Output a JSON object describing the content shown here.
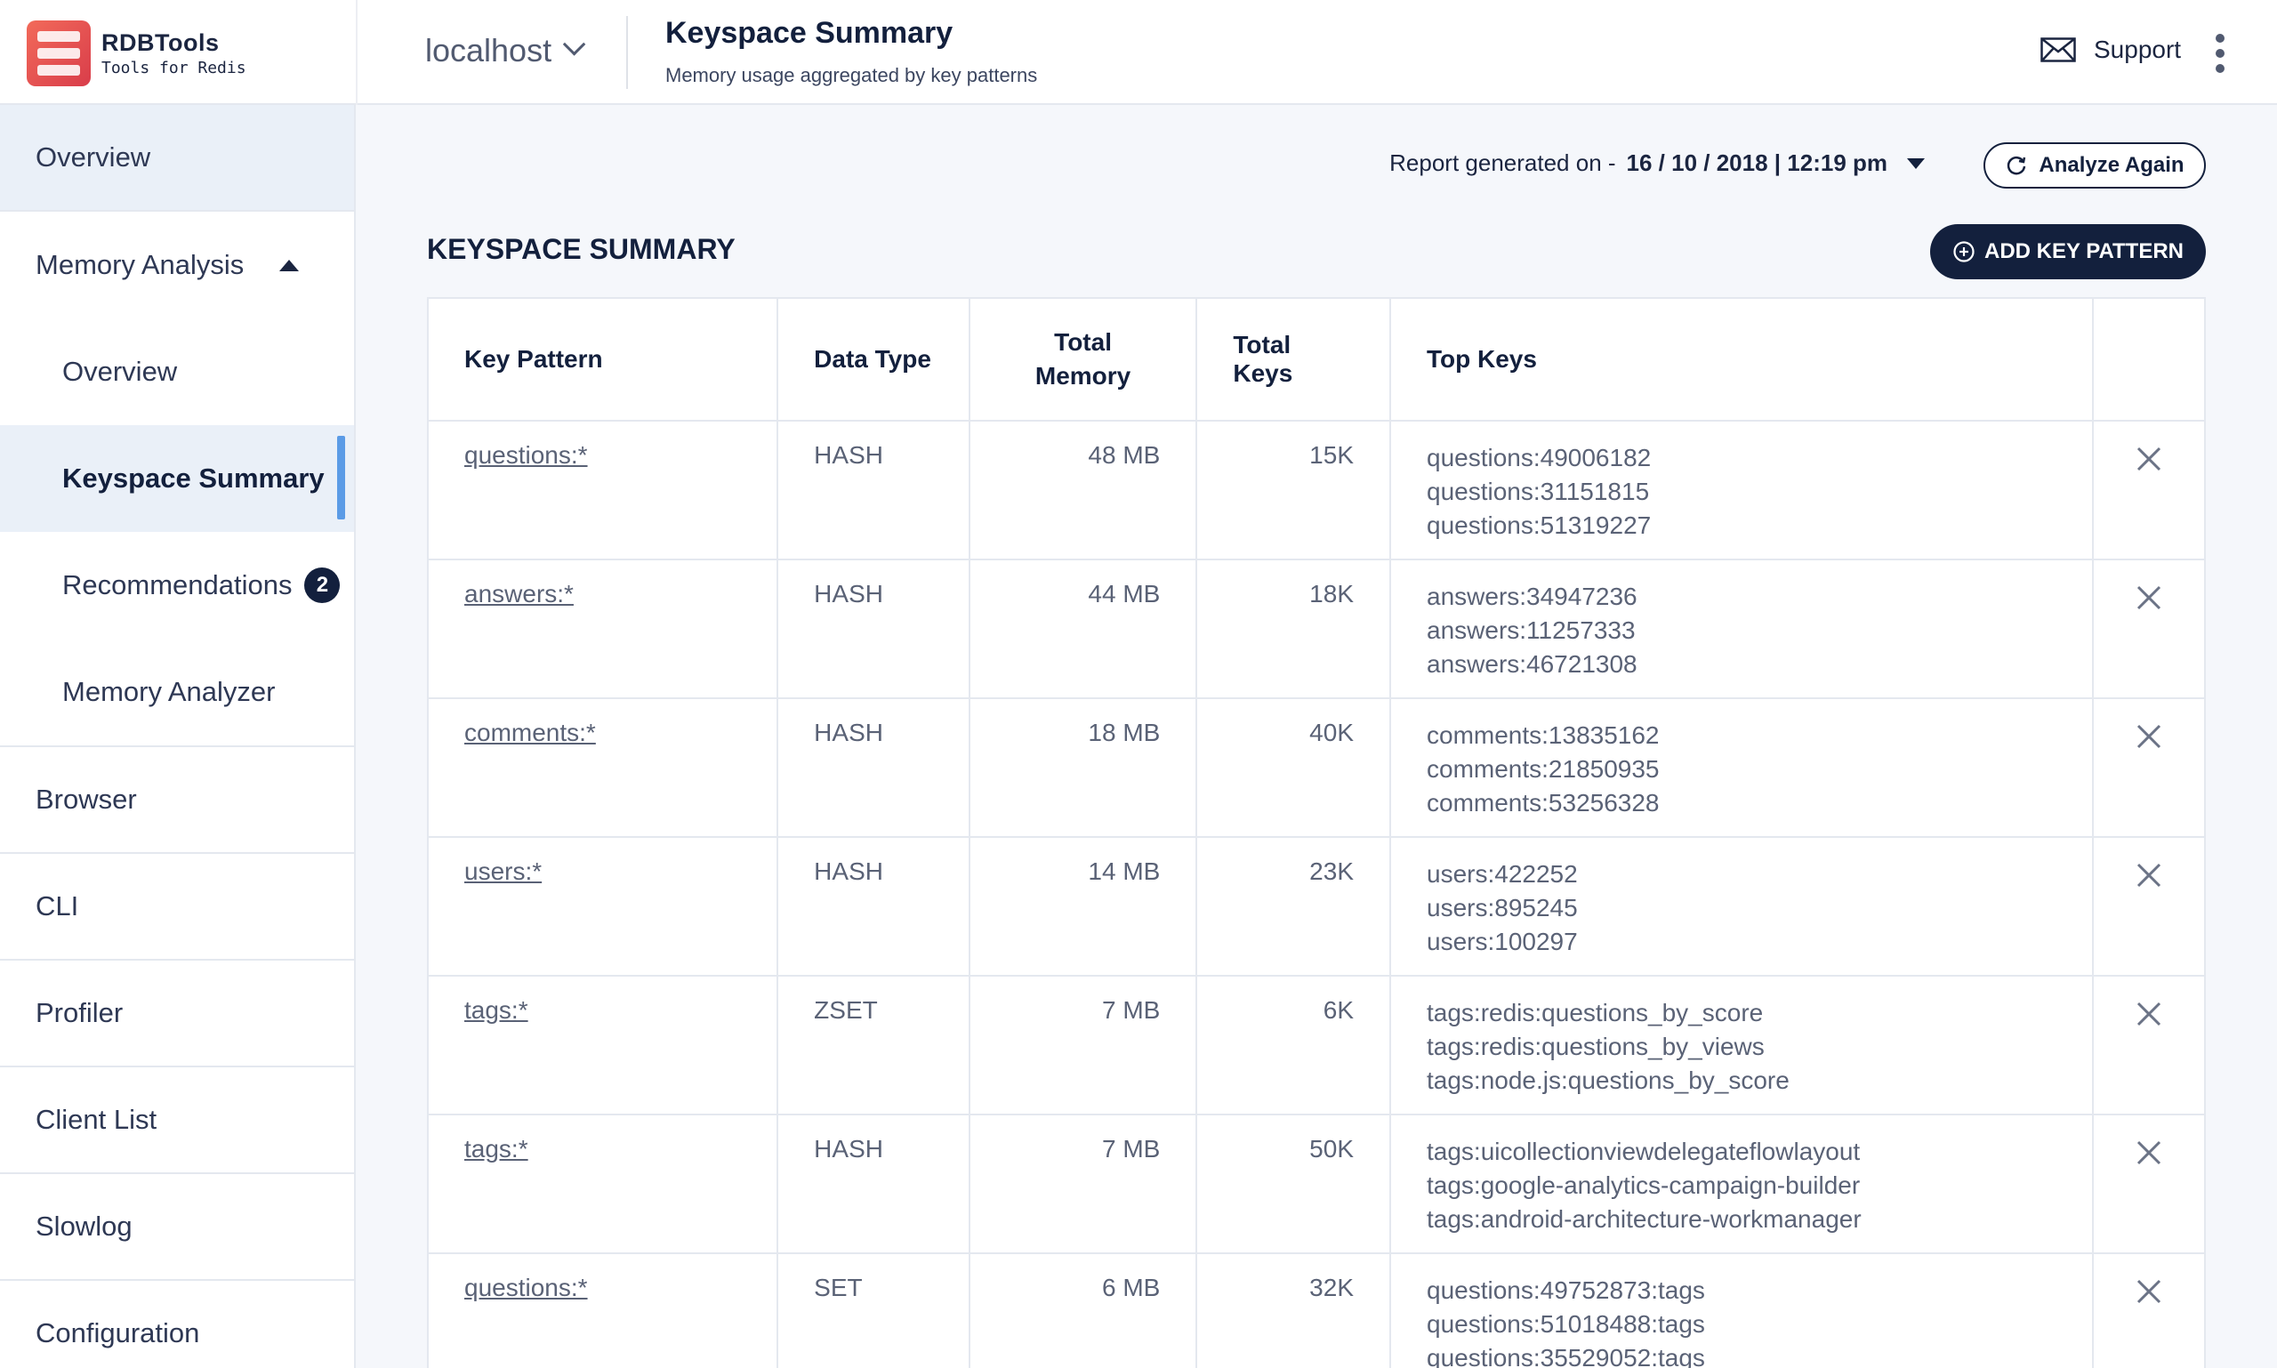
{
  "brand": {
    "name": "RDBTools",
    "tagline": "Tools for Redis"
  },
  "header": {
    "host": "localhost",
    "title": "Keyspace Summary",
    "subtitle": "Memory usage aggregated by key patterns",
    "support_label": "Support"
  },
  "sidebar": {
    "overview": "Overview",
    "memory_analysis": {
      "label": "Memory Analysis",
      "children": {
        "overview": "Overview",
        "keyspace_summary": "Keyspace Summary",
        "recommendations": "Recommendations",
        "recommendations_count": "2",
        "memory_analyzer": "Memory Analyzer"
      }
    },
    "browser": "Browser",
    "cli": "CLI",
    "profiler": "Profiler",
    "client_list": "Client List",
    "slowlog": "Slowlog",
    "configuration": "Configuration"
  },
  "report": {
    "label": "Report generated on -",
    "datetime": "16 / 10 / 2018 | 12:19 pm",
    "analyze_label": "Analyze Again"
  },
  "section": {
    "title": "KEYSPACE SUMMARY",
    "add_label": "ADD KEY PATTERN"
  },
  "table": {
    "headers": {
      "key_pattern": "Key Pattern",
      "data_type": "Data Type",
      "total_memory": "Total Memory",
      "total_keys": "Total Keys",
      "top_keys": "Top Keys"
    },
    "rows": [
      {
        "pattern": "questions:*",
        "type": "HASH",
        "memory": "48 MB",
        "keys": "15K",
        "top": [
          "questions:49006182",
          "questions:31151815",
          "questions:51319227"
        ]
      },
      {
        "pattern": "answers:*",
        "type": "HASH",
        "memory": "44 MB",
        "keys": "18K",
        "top": [
          "answers:34947236",
          "answers:11257333",
          "answers:46721308"
        ]
      },
      {
        "pattern": "comments:*",
        "type": "HASH",
        "memory": "18 MB",
        "keys": "40K",
        "top": [
          "comments:13835162",
          "comments:21850935",
          "comments:53256328"
        ]
      },
      {
        "pattern": "users:*",
        "type": "HASH",
        "memory": "14 MB",
        "keys": "23K",
        "top": [
          "users:422252",
          "users:895245",
          "users:100297"
        ]
      },
      {
        "pattern": "tags:*",
        "type": "ZSET",
        "memory": "7 MB",
        "keys": "6K",
        "top": [
          "tags:redis:questions_by_score",
          "tags:redis:questions_by_views",
          "tags:node.js:questions_by_score"
        ]
      },
      {
        "pattern": "tags:*",
        "type": "HASH",
        "memory": "7 MB",
        "keys": "50K",
        "top": [
          "tags:uicollectionviewdelegateflowlayout",
          "tags:google-analytics-campaign-builder",
          "tags:android-architecture-workmanager"
        ]
      },
      {
        "pattern": "questions:*",
        "type": "SET",
        "memory": "6 MB",
        "keys": "32K",
        "top": [
          "questions:49752873:tags",
          "questions:51018488:tags",
          "questions:35529052:tags"
        ]
      }
    ]
  },
  "colors": {
    "accent": "#13203d",
    "highlight": "#5b9be6",
    "logo": "#e8505b",
    "selected_bg": "#eaf0f8"
  },
  "icons": {
    "mail": "envelope-icon",
    "menu": "kebab-menu-icon",
    "refresh": "refresh-icon",
    "add": "plus-circle-icon",
    "delete": "close-icon"
  }
}
